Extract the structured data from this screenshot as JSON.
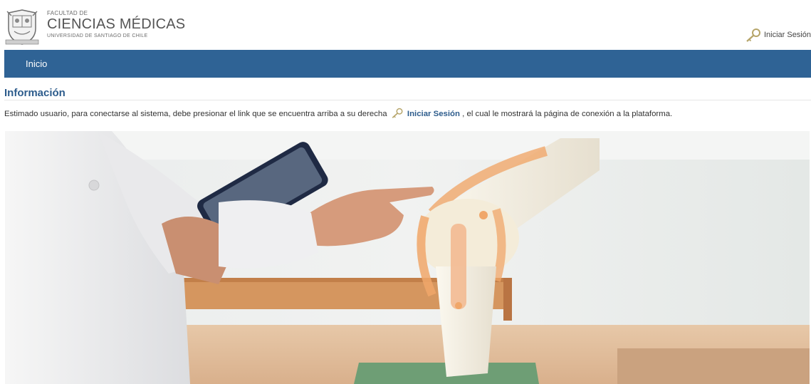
{
  "header": {
    "logo": {
      "line1": "FACULTAD DE",
      "line2": "CIENCIAS MÉDICAS",
      "line3": "UNIVERSIDAD DE SANTIAGO DE CHILE"
    },
    "login_label": "Iniciar Sesión",
    "login_icon": "key-icon"
  },
  "nav": {
    "items": [
      {
        "label": "Inicio"
      }
    ]
  },
  "main": {
    "title": "Información",
    "info": {
      "before": "Estimado usuario, para conectarse al sistema, debe presionar el link que se encuentra arriba a su derecha",
      "link": "Iniciar Sesión",
      "after": ", el cual le mostrará la página de conexión a la plataforma."
    }
  },
  "colors": {
    "nav_bg": "#2f6395",
    "title": "#2d5c8c"
  }
}
